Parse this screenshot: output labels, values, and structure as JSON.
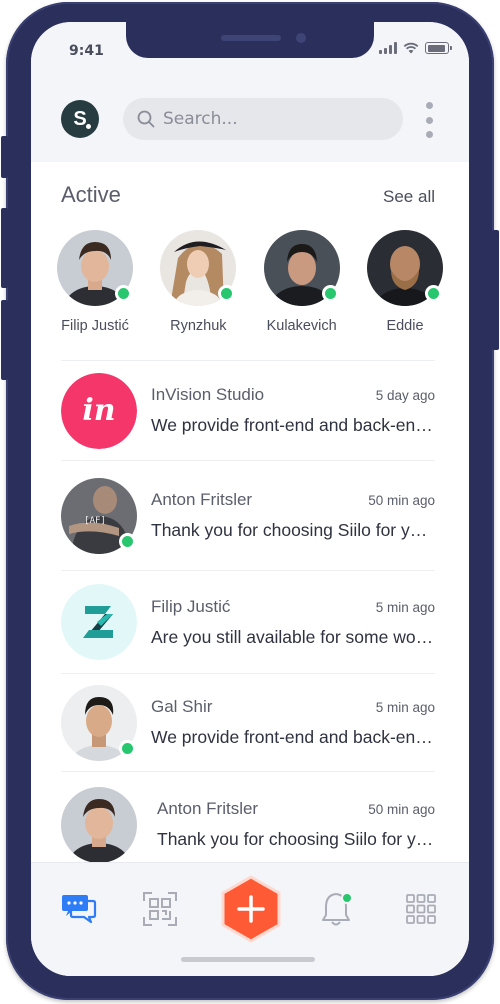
{
  "status_bar": {
    "time": "9:41"
  },
  "header": {
    "logo_letter": "S",
    "search": {
      "placeholder": "Search...",
      "value": ""
    }
  },
  "active": {
    "title": "Active",
    "see_all": "See all",
    "users": [
      {
        "name": "Filip Justić",
        "online": true
      },
      {
        "name": "Rynzhuk",
        "online": true
      },
      {
        "name": "Kulakevich",
        "online": true
      },
      {
        "name": "Eddie",
        "online": true
      }
    ]
  },
  "chats": [
    {
      "name": "InVision Studio",
      "time": "5 day ago",
      "message": "We provide front-end and back-end development",
      "online": false
    },
    {
      "name": "Anton Fritsler",
      "time": "50 min ago",
      "message": "Thank you for choosing Siilo for your team",
      "online": true
    },
    {
      "name": "Filip Justić",
      "time": "5 min ago",
      "message": "Are you still available for some work?",
      "online": false
    },
    {
      "name": "Gal Shir",
      "time": "5 min ago",
      "message": "We provide front-end and back-end development",
      "online": true
    },
    {
      "name": "Anton Fritsler",
      "time": "50 min ago",
      "message": "Thank you for choosing Siilo for your team",
      "online": false
    }
  ],
  "tabbar": {
    "items": [
      "chat-icon",
      "qr-code-icon",
      "plus-icon",
      "bell-icon",
      "grid-icon"
    ],
    "active": "chat-icon",
    "bell_badge": true
  },
  "colors": {
    "accent_blue": "#2f7df6",
    "fab_orange": "#ff5a36",
    "online_green": "#28c76f",
    "invision_pink": "#f5366a",
    "phone_frame": "#2b2f5c"
  }
}
